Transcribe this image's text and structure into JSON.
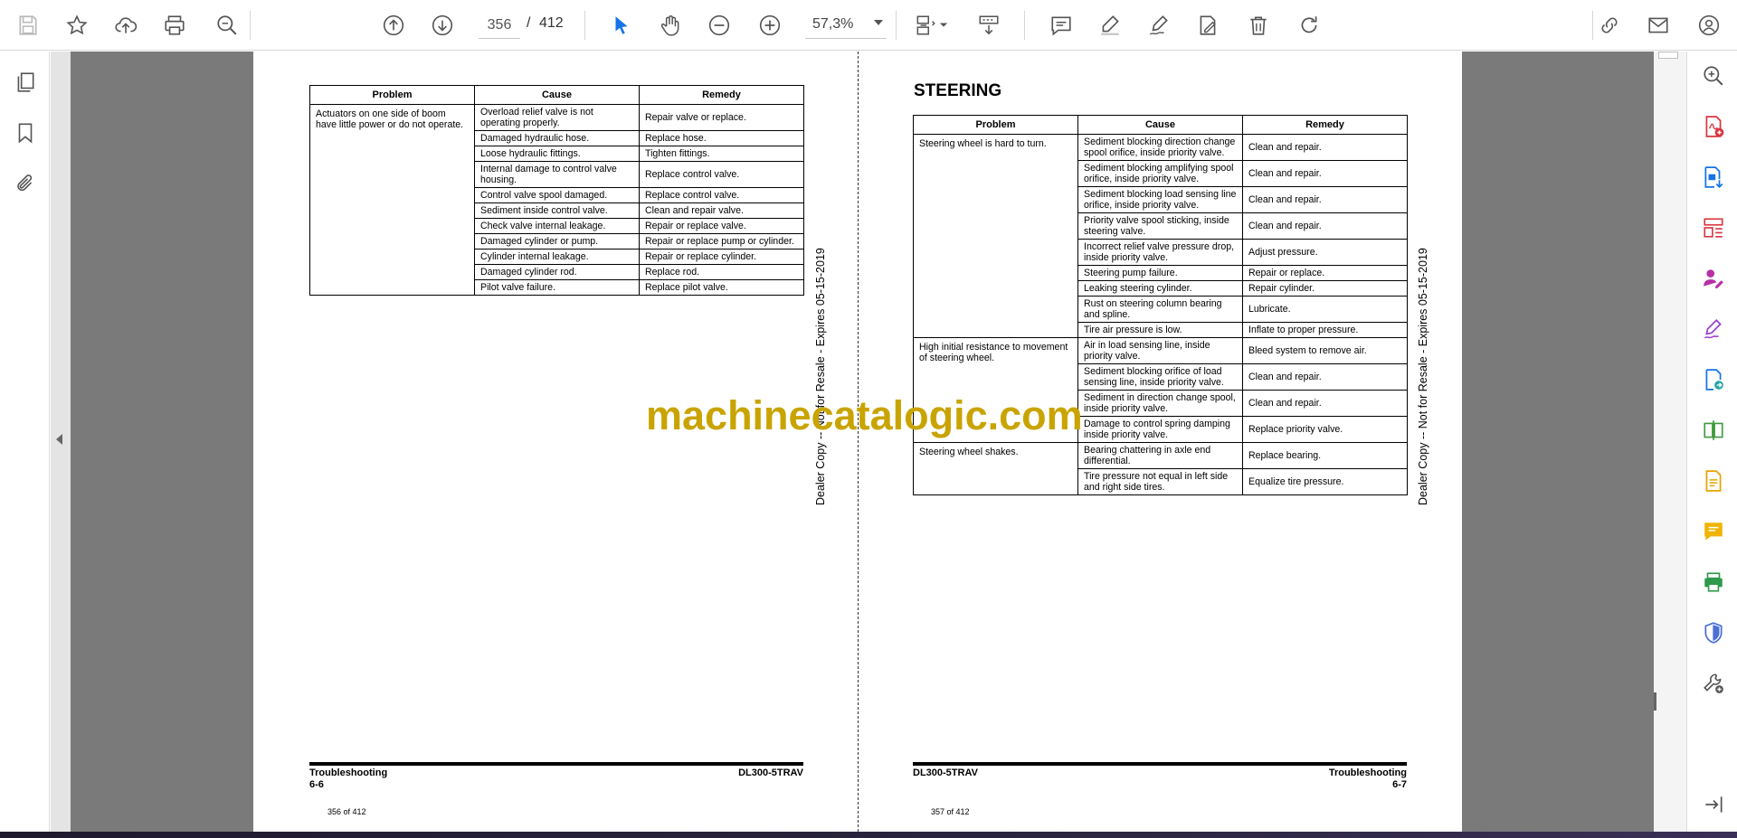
{
  "toolbar": {
    "page_current": "356",
    "page_separator": "/",
    "page_total": "412",
    "zoom": "57,3%",
    "icons": [
      "save-icon",
      "star-icon",
      "cloud-upload-icon",
      "print-icon",
      "search-zoom-icon",
      "page-up-icon",
      "page-down-icon",
      "select-cursor-icon",
      "hand-icon",
      "zoom-out-icon",
      "zoom-in-icon",
      "fit-page-icon",
      "scroll-mode-icon",
      "comment-icon",
      "highlight-icon",
      "sign-icon",
      "fill-sign-icon",
      "delete-icon",
      "rotate-icon",
      "share-link-icon",
      "email-icon",
      "account-icon"
    ]
  },
  "left_page": {
    "headers": [
      "Problem",
      "Cause",
      "Remedy"
    ],
    "groups": [
      {
        "problem": "Actuators on one side of boom have little power or do not operate.",
        "rows": [
          [
            "Overload relief valve is not operating properly.",
            "Repair valve or replace."
          ],
          [
            "Damaged hydraulic hose.",
            "Replace hose."
          ],
          [
            "Loose hydraulic fittings.",
            "Tighten fittings."
          ],
          [
            "Internal damage to control valve housing.",
            "Replace control valve."
          ],
          [
            "Control valve spool damaged.",
            "Replace control valve."
          ],
          [
            "Sediment inside control valve.",
            "Clean and repair valve."
          ],
          [
            "Check valve internal leakage.",
            "Repair or replace valve."
          ],
          [
            "Damaged cylinder or pump.",
            "Repair or replace pump or cylinder."
          ],
          [
            "Cylinder internal leakage.",
            "Repair or replace cylinder."
          ],
          [
            "Damaged cylinder rod.",
            "Replace rod."
          ],
          [
            "Pilot valve failure.",
            "Replace pilot valve."
          ]
        ]
      }
    ],
    "footer_left": "Troubleshooting",
    "footer_left_sub": "6-6",
    "footer_right": "DL300-5TRAV",
    "page_count": "356 of 412",
    "dealer_text": "Dealer Copy -- Not for Resale - Expires 05-15-2019"
  },
  "right_page": {
    "section_title": "STEERING",
    "headers": [
      "Problem",
      "Cause",
      "Remedy"
    ],
    "groups": [
      {
        "problem": "Steering wheel is hard to turn.",
        "rows": [
          [
            "Sediment blocking direction change spool orifice, inside priority valve.",
            "Clean and repair."
          ],
          [
            "Sediment blocking amplifying spool orifice, inside priority valve.",
            "Clean and repair."
          ],
          [
            "Sediment blocking load sensing line orifice, inside priority valve.",
            "Clean and repair."
          ],
          [
            "Priority valve spool sticking, inside steering valve.",
            "Clean and repair."
          ],
          [
            "Incorrect relief valve pressure drop, inside priority valve.",
            "Adjust pressure."
          ],
          [
            "Steering pump failure.",
            "Repair or replace."
          ],
          [
            "Leaking steering cylinder.",
            "Repair cylinder."
          ],
          [
            "Rust on steering column bearing and spline.",
            "Lubricate."
          ],
          [
            "Tire air pressure is low.",
            "Inflate to proper pressure."
          ]
        ]
      },
      {
        "problem": "High initial resistance to movement of steering wheel.",
        "rows": [
          [
            "Air in load sensing line, inside priority valve.",
            "Bleed system to remove air."
          ],
          [
            "Sediment blocking orifice of load sensing line, inside priority valve.",
            "Clean and repair."
          ],
          [
            "Sediment in direction change spool, inside priority valve.",
            "Clean and repair."
          ],
          [
            "Damage to control spring damping inside priority valve.",
            "Replace priority valve."
          ]
        ]
      },
      {
        "problem": "Steering wheel shakes.",
        "rows": [
          [
            "Bearing chattering in axle end differential.",
            "Replace bearing."
          ],
          [
            "Tire pressure not equal in left side and right side tires.",
            "Equalize tire pressure."
          ]
        ]
      }
    ],
    "footer_left": "DL300-5TRAV",
    "footer_right": "Troubleshooting",
    "footer_right_sub": "6-7",
    "page_count": "357 of 412",
    "dealer_text": "Dealer Copy -- Not for Resale - Expires 05-15-2019"
  },
  "watermark": "machinecatalogic.com",
  "right_tools": [
    "zoom-tool-icon",
    "create-pdf-icon",
    "export-pdf-icon",
    "organize-pages-icon",
    "request-signature-icon",
    "fill-sign-tool-icon",
    "send-for-review-icon",
    "compare-icon",
    "edit-pdf-icon",
    "comment-tool-icon",
    "print-production-icon",
    "protect-icon",
    "more-tools-icon",
    "expand-panel-icon"
  ],
  "colors": {
    "accent_blue": "#1473e6",
    "pdf_red": "#d7373f",
    "watermark": "#c9a400",
    "doc_gutter": "#7a7a7a"
  }
}
